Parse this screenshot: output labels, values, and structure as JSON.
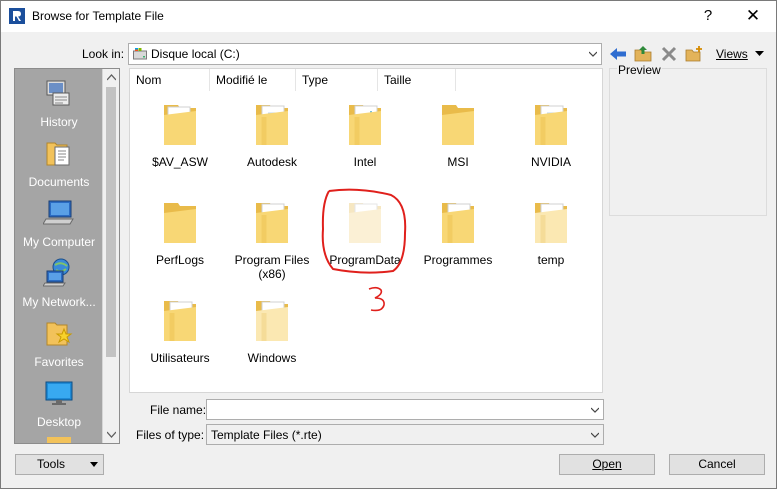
{
  "window": {
    "title": "Browse for Template File",
    "help_label": "?",
    "close_label": "✕"
  },
  "lookin": {
    "label": "Look in:",
    "value": "Disque local (C:)"
  },
  "toolbar": {
    "views_label": "Views"
  },
  "places": [
    {
      "label": "History",
      "icon": "history-icon"
    },
    {
      "label": "Documents",
      "icon": "documents-icon"
    },
    {
      "label": "My Computer",
      "icon": "my-computer-icon"
    },
    {
      "label": "My Network...",
      "icon": "network-icon"
    },
    {
      "label": "Favorites",
      "icon": "favorites-icon"
    },
    {
      "label": "Desktop",
      "icon": "desktop-icon"
    }
  ],
  "columns": [
    "Nom",
    "Modifié le",
    "Type",
    "Taille"
  ],
  "folders": [
    {
      "name": "$AV_ASW"
    },
    {
      "name": "Autodesk"
    },
    {
      "name": "Intel"
    },
    {
      "name": "MSI"
    },
    {
      "name": "NVIDIA"
    },
    {
      "name": "PerfLogs"
    },
    {
      "name": "Program Files (x86)"
    },
    {
      "name": "ProgramData"
    },
    {
      "name": "Programmes"
    },
    {
      "name": "temp"
    },
    {
      "name": "Utilisateurs"
    },
    {
      "name": "Windows"
    }
  ],
  "annotation": {
    "number": "3",
    "color": "#e0201c"
  },
  "preview": {
    "label": "Preview"
  },
  "filename": {
    "label": "File name:",
    "value": ""
  },
  "filetype": {
    "label": "Files of type:",
    "value": "Template Files  (*.rte)"
  },
  "buttons": {
    "tools": "Tools",
    "open": "Open",
    "cancel": "Cancel"
  },
  "colors": {
    "folder_yellow": "#f8d775",
    "places_bg": "#a5a5a5"
  }
}
